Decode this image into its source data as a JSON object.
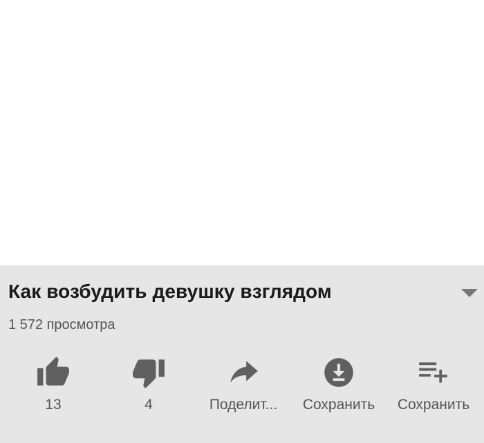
{
  "video": {
    "title": "Как возбудить девушку взглядом",
    "views": "1 572 просмотра"
  },
  "actions": {
    "like": {
      "icon": "thumbs-up-icon",
      "label": "13"
    },
    "dislike": {
      "icon": "thumbs-down-icon",
      "label": "4"
    },
    "share": {
      "icon": "share-icon",
      "label": "Поделит..."
    },
    "download": {
      "icon": "download-icon",
      "label": "Сохранить"
    },
    "save": {
      "icon": "playlist-add-icon",
      "label": "Сохранить"
    }
  },
  "colors": {
    "panel_background": "#e6e6e6",
    "icon": "#606060",
    "title_text": "#1a1a1a",
    "secondary_text": "#555555"
  }
}
